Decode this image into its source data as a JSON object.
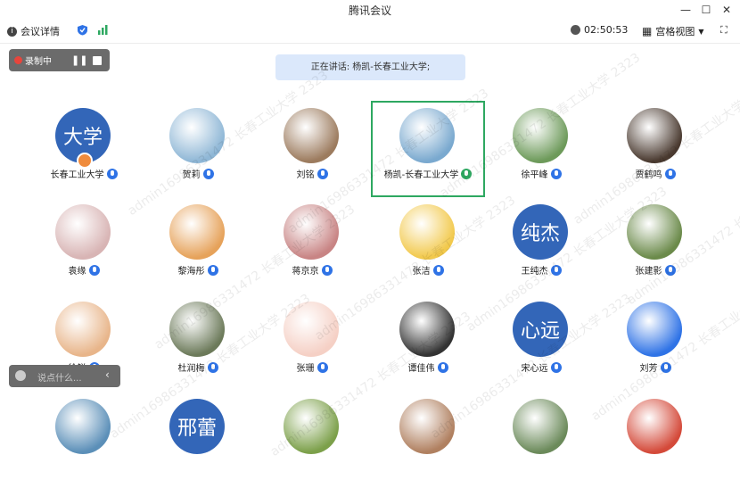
{
  "window": {
    "title": "腾讯会议",
    "minimize": "—",
    "maximize": "☐",
    "close": "✕"
  },
  "toolbar": {
    "meeting_details": "会议详情",
    "timer": "02:50:53",
    "view_mode": "宫格视图"
  },
  "recording": {
    "label": "录制中"
  },
  "speaking": {
    "text": "正在讲话: 杨凯-长春工业大学;"
  },
  "chat": {
    "placeholder": "说点什么..."
  },
  "participants": [
    {
      "name": "长春工业大学",
      "avatar_text": "大学",
      "host": true
    },
    {
      "name": "贺莉",
      "avatar_text": ""
    },
    {
      "name": "刘铭",
      "avatar_text": ""
    },
    {
      "name": "杨凯-长春工业大学",
      "avatar_text": "",
      "active": true
    },
    {
      "name": "徐平峰",
      "avatar_text": ""
    },
    {
      "name": "贾鹤鸣",
      "avatar_text": ""
    },
    {
      "name": "袁缘",
      "avatar_text": ""
    },
    {
      "name": "黎海彤",
      "avatar_text": ""
    },
    {
      "name": "蒋京京",
      "avatar_text": ""
    },
    {
      "name": "张洁",
      "avatar_text": ""
    },
    {
      "name": "王纯杰",
      "avatar_text": "纯杰"
    },
    {
      "name": "张建影",
      "avatar_text": ""
    },
    {
      "name": "徐锐",
      "avatar_text": ""
    },
    {
      "name": "杜润梅",
      "avatar_text": ""
    },
    {
      "name": "张珊",
      "avatar_text": ""
    },
    {
      "name": "谭佳伟",
      "avatar_text": ""
    },
    {
      "name": "宋心远",
      "avatar_text": "心远"
    },
    {
      "name": "刘芳",
      "avatar_text": ""
    },
    {
      "name": "",
      "avatar_text": ""
    },
    {
      "name": "",
      "avatar_text": "邢蕾"
    },
    {
      "name": "",
      "avatar_text": ""
    },
    {
      "name": "",
      "avatar_text": ""
    },
    {
      "name": "",
      "avatar_text": ""
    },
    {
      "name": "",
      "avatar_text": ""
    }
  ],
  "watermark": "admin16986331472 长春工业大学 2323"
}
